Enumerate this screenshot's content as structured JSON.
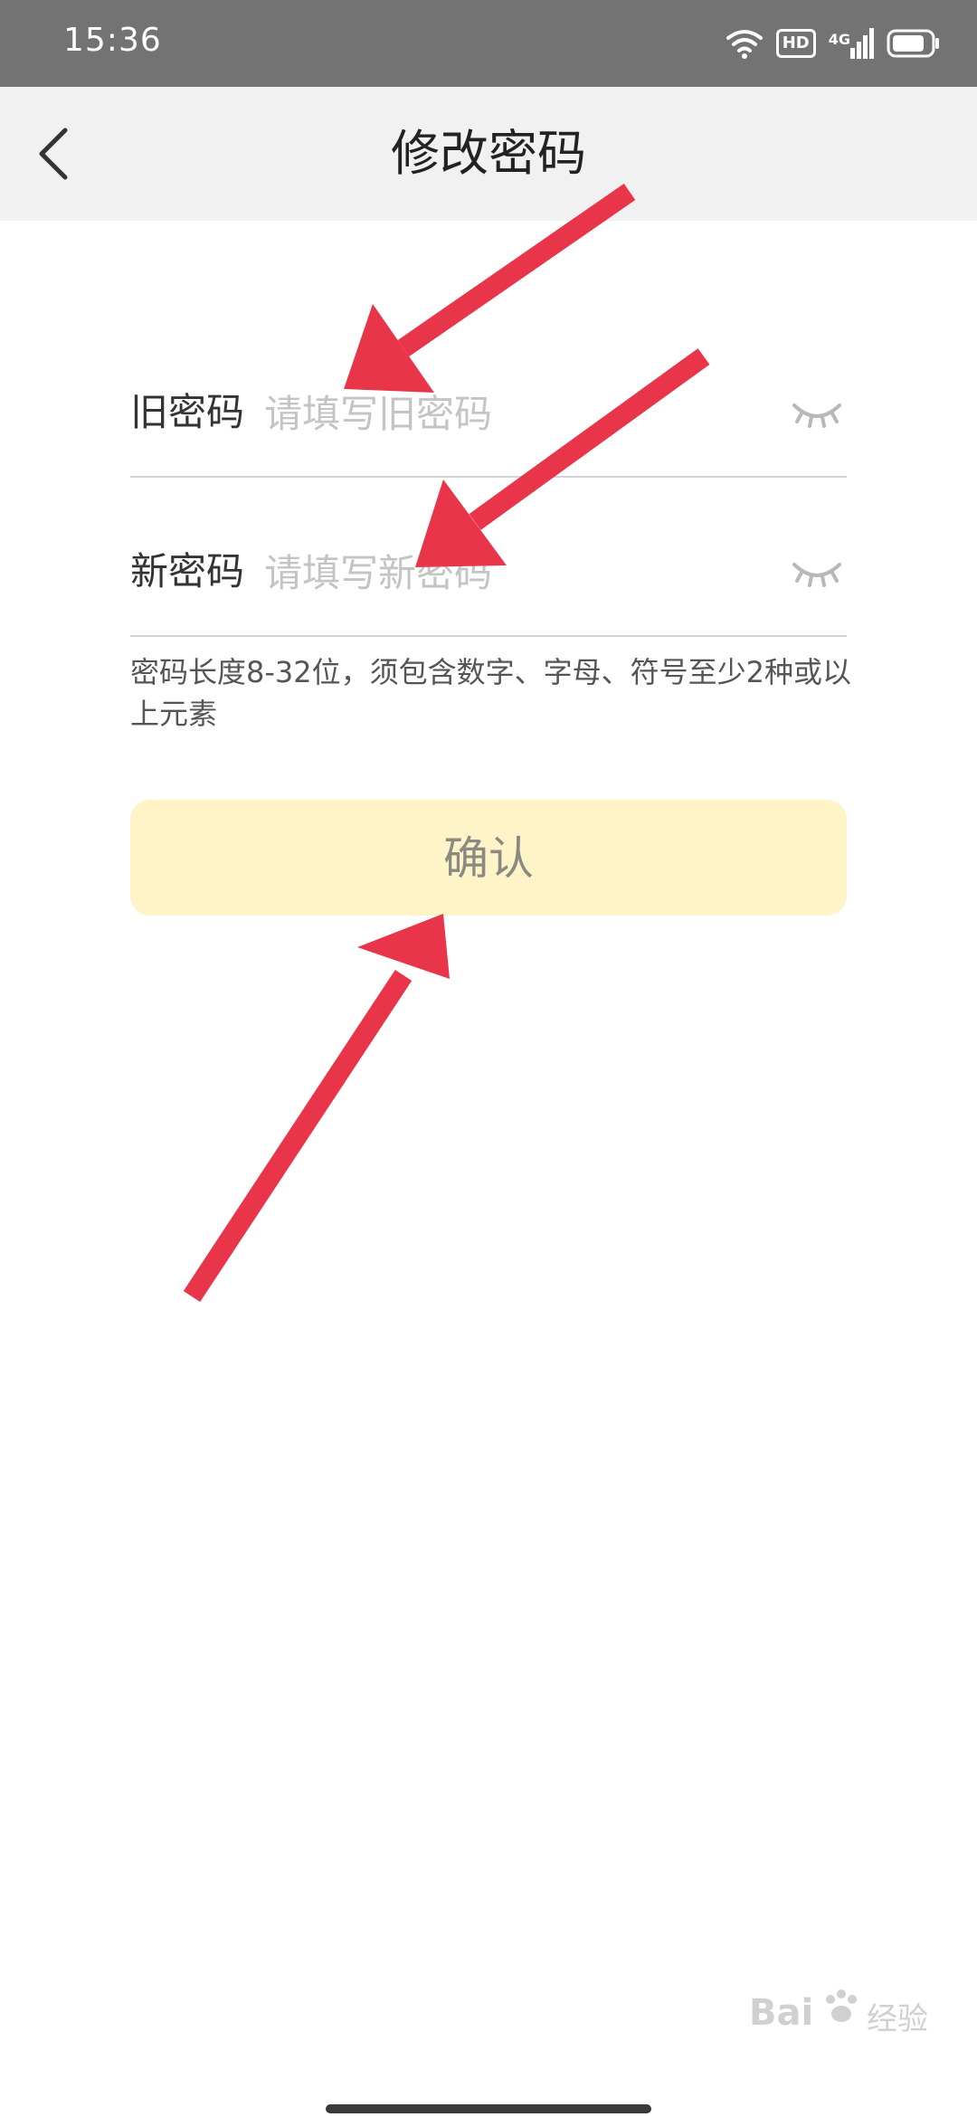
{
  "status_bar": {
    "time": "15:36",
    "hd_label": "HD",
    "network_label": "4G",
    "icons": [
      "wifi-icon",
      "hd-icon",
      "signal-4g-icon",
      "battery-icon"
    ]
  },
  "header": {
    "title": "修改密码",
    "back_icon": "chevron-left-icon"
  },
  "form": {
    "old_password": {
      "label": "旧密码",
      "placeholder": "请填写旧密码",
      "value": ""
    },
    "new_password": {
      "label": "新密码",
      "placeholder": "请填写新密码",
      "value": ""
    },
    "hint": "密码长度8-32位，须包含数字、字母、符号至少2种或以上元素"
  },
  "confirm_button": {
    "label": "确认"
  },
  "watermark": {
    "brand": "Bai",
    "suffix": "经验"
  },
  "colors": {
    "status_bar": "#737373",
    "header_bg": "#f1f1f1",
    "button_bg": "#fff3c8",
    "annotation_arrow": "#e8354a"
  }
}
